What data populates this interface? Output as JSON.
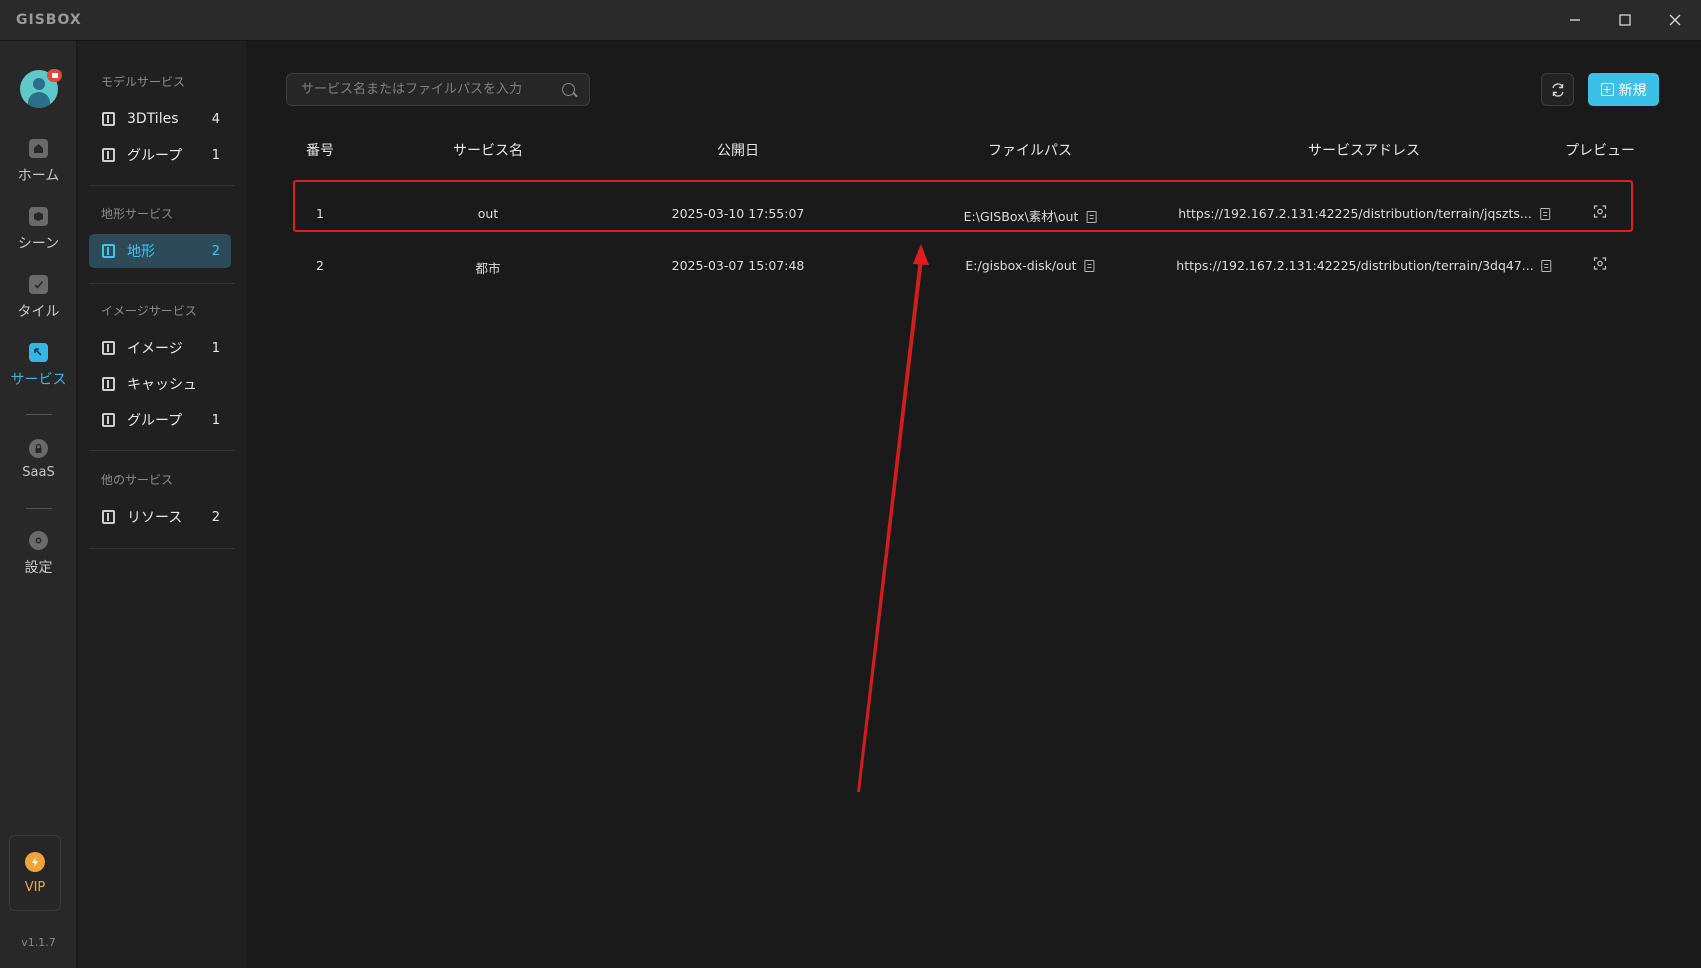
{
  "app": {
    "logo": "GISBOX",
    "version": "v1.1.7"
  },
  "window_controls": [
    "minimize",
    "maximize",
    "close"
  ],
  "rail": {
    "items": [
      {
        "label": "ホーム",
        "icon": "home-icon"
      },
      {
        "label": "シーン",
        "icon": "scene-icon"
      },
      {
        "label": "タイル",
        "icon": "tile-icon"
      },
      {
        "label": "サービス",
        "icon": "service-icon",
        "active": true
      },
      {
        "label": "SaaS",
        "icon": "saas-icon"
      },
      {
        "label": "設定",
        "icon": "settings-icon"
      }
    ],
    "vip_label": "VIP"
  },
  "subnav": {
    "sections": [
      {
        "title": "モデルサービス",
        "items": [
          {
            "label": "3DTiles",
            "count": "4"
          },
          {
            "label": "グループ",
            "count": "1"
          }
        ]
      },
      {
        "title": "地形サービス",
        "items": [
          {
            "label": "地形",
            "count": "2",
            "active": true
          }
        ]
      },
      {
        "title": "イメージサービス",
        "items": [
          {
            "label": "イメージ",
            "count": "1"
          },
          {
            "label": "キャッシュ",
            "count": ""
          },
          {
            "label": "グループ",
            "count": "1"
          }
        ]
      },
      {
        "title": "他のサービス",
        "items": [
          {
            "label": "リソース",
            "count": "2"
          }
        ]
      }
    ]
  },
  "toolbar": {
    "search_placeholder": "サービス名またはファイルパスを入力",
    "new_label": "新規"
  },
  "table": {
    "headers": [
      "番号",
      "サービス名",
      "公開日",
      "ファイルパス",
      "サービスアドレス",
      "プレビュー"
    ],
    "rows": [
      {
        "no": "1",
        "name": "out",
        "date": "2025-03-10 17:55:07",
        "path": "E:\\GISBox\\素材\\out",
        "address": "https://192.167.2.131:42225/distribution/terrain/jqszts..."
      },
      {
        "no": "2",
        "name": "都市",
        "date": "2025-03-07 15:07:48",
        "path": "E:/gisbox-disk/out",
        "address": "https://192.167.2.131:42225/distribution/terrain/3dq47..."
      }
    ]
  },
  "colors": {
    "accent": "#3cc0e8",
    "highlight": "#e11d1d",
    "vip": "#f0a33a"
  }
}
